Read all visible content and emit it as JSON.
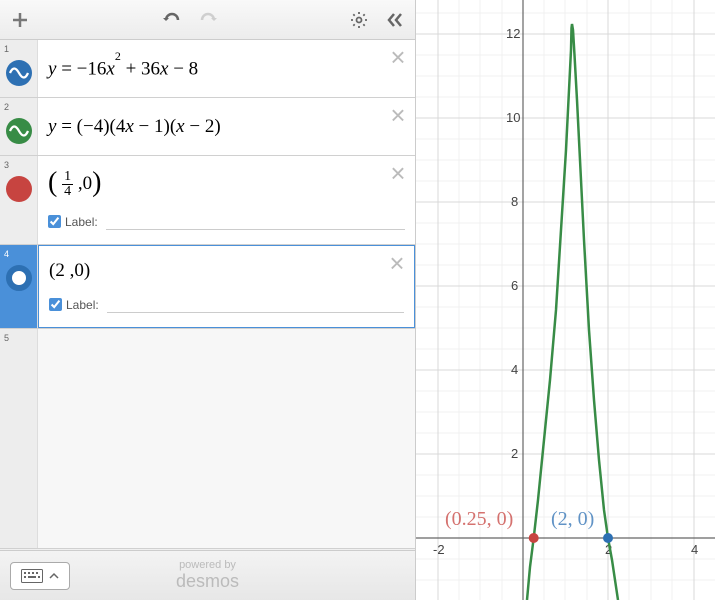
{
  "toolbar": {
    "add": "+",
    "undo": "↶",
    "redo": "↷",
    "settings": "⚙",
    "collapse": "«"
  },
  "expressions": [
    {
      "index": "1",
      "type": "function",
      "color": "blue",
      "latex_display": "y = −16x² + 36x − 8"
    },
    {
      "index": "2",
      "type": "function",
      "color": "green",
      "latex_display": "y = (−4)(4x − 1)(x − 2)"
    },
    {
      "index": "3",
      "type": "point",
      "color": "red",
      "latex_display": "(¼, 0)",
      "label_checked": true,
      "label_text": "Label:"
    },
    {
      "index": "4",
      "type": "point",
      "color": "blue-hollow",
      "latex_display": "(2, 0)",
      "label_checked": true,
      "label_text": "Label:",
      "selected": true
    },
    {
      "index": "5",
      "type": "empty"
    }
  ],
  "footer": {
    "powered_by": "powered by",
    "brand": "desmos"
  },
  "chart_data": {
    "type": "function-plot",
    "xlim": [
      -2.5,
      4.5
    ],
    "ylim": [
      -1.5,
      12.8
    ],
    "x_ticks": [
      -2,
      2,
      4
    ],
    "y_ticks": [
      2,
      4,
      6,
      8,
      10,
      12
    ],
    "series": [
      {
        "name": "y=-16x^2+36x-8",
        "color": "#2d70b3"
      },
      {
        "name": "y=(-4)(4x-1)(x-2)",
        "color": "#388c46"
      }
    ],
    "points": [
      {
        "x": 0.25,
        "y": 0,
        "color": "#c74440",
        "label": "(0.25, 0)"
      },
      {
        "x": 2,
        "y": 0,
        "color": "#2d70b3",
        "label": "(2, 0)"
      }
    ],
    "point_labels": {
      "red": "(0.25, 0)",
      "blue": "(2, 0)"
    }
  }
}
